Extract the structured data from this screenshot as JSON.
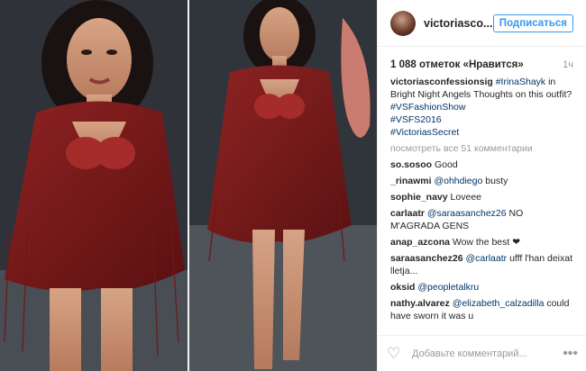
{
  "header": {
    "username": "victoriasco...",
    "follow_label": "Подписаться"
  },
  "meta": {
    "likes": "1 088 отметок «Нравится»",
    "time": "1ч"
  },
  "caption": {
    "username": "victoriasconfessionsig",
    "mention": "#IrinaShayk",
    "text": "in Bright Night Angels",
    "text2": "Thoughts on this outfit?",
    "tags": [
      "#VSFashionShow",
      "#VSFS2016",
      "#VictoriasSecret"
    ]
  },
  "view_all": "посмотреть все 51 комментарии",
  "comments": [
    {
      "user": "so.sosoo",
      "text": "Good"
    },
    {
      "user": "_rinawmi",
      "mention": "@ohhdiego",
      "text": "busty"
    },
    {
      "user": "sophie_navy",
      "text": "Loveee"
    },
    {
      "user": "carlaatr",
      "mention": "@saraasanchez26",
      "text": "NO M'AGRADA GENS"
    },
    {
      "user": "anap_azcona",
      "text": "Wow the best ❤"
    },
    {
      "user": "saraasanchez26",
      "mention": "@carlaatr",
      "text": "ufff l'han deixat lletja..."
    },
    {
      "user": "oksid",
      "mention": "@peopletalkru",
      "text": ""
    },
    {
      "user": "nathy.alvarez",
      "mention": "@elizabeth_calzadilla",
      "text": "could have sworn it was u"
    }
  ],
  "footer": {
    "add_comment_placeholder": "Добавьте комментарий...",
    "more": "•••"
  },
  "colors": {
    "accent": "#3897f0",
    "link": "#003569",
    "muted": "#999999",
    "outfit": "#7a1d1d"
  },
  "icons": {
    "heart": "heart-outline-icon",
    "more": "more-dots-icon"
  }
}
